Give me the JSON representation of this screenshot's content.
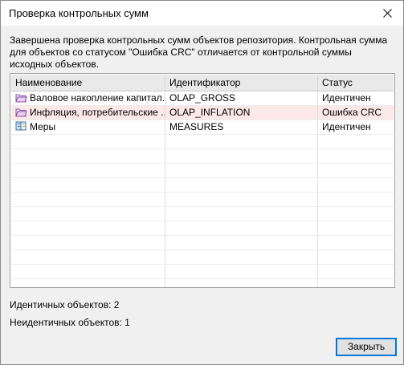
{
  "window": {
    "title": "Проверка контрольных сумм"
  },
  "message": "Завершена проверка контрольных сумм объектов репозитория. Контрольная сумма для объектов со статусом \"Ошибка CRC\" отличается от контрольной суммы исходных объектов.",
  "table": {
    "headers": [
      "Наименование",
      "Идентификатор",
      "Статус"
    ],
    "rows": [
      {
        "name": "Валовое накопление капитал...",
        "id": "OLAP_GROSS",
        "status": "Идентичен",
        "icon": "folder-icon"
      },
      {
        "name": "Инфляция, потребительские ...",
        "id": "OLAP_INFLATION",
        "status": "Ошибка CRC",
        "icon": "folder-icon"
      },
      {
        "name": "Меры",
        "id": "MEASURES",
        "status": "Идентичен",
        "icon": "book-icon"
      }
    ]
  },
  "summary": {
    "identical": "Идентичных объектов: 2",
    "nonidentical": "Неидентичных объектов: 1"
  },
  "buttons": {
    "close_label": "Закрыть"
  },
  "colors": {
    "error_row": "#fde8e8",
    "accent": "#0078d7"
  }
}
